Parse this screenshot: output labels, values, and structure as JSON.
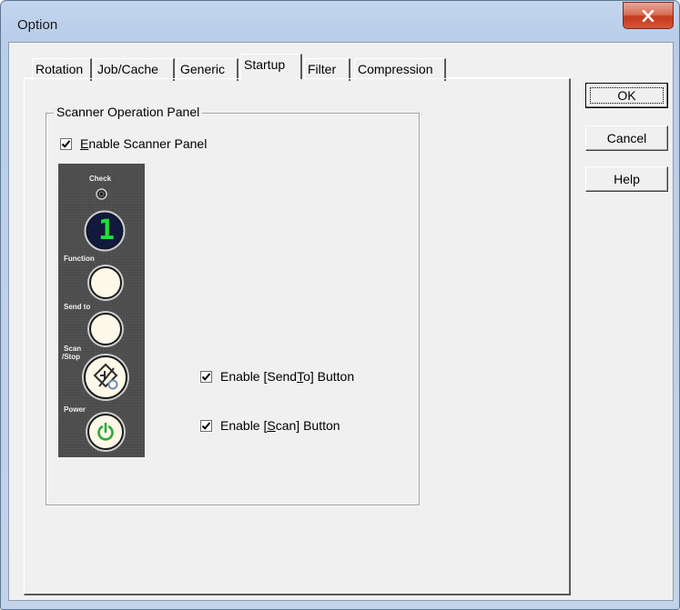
{
  "window": {
    "title": "Option",
    "close_glyph": "✕"
  },
  "tabs": [
    {
      "label": "Rotation",
      "active": false
    },
    {
      "label": "Job/Cache",
      "active": false
    },
    {
      "label": "Generic",
      "active": false
    },
    {
      "label": "Startup",
      "active": true
    },
    {
      "label": "Filter",
      "active": false
    },
    {
      "label": "Compression",
      "active": false
    }
  ],
  "group": {
    "label": "Scanner Operation Panel"
  },
  "enable_panel": {
    "mnemonic": "E",
    "rest": "nable Scanner Panel",
    "checked": true
  },
  "scanner_panel": {
    "check_label": "Check",
    "function_label": "Function",
    "sendto_label": "Send to",
    "scan_label_1": "Scan",
    "scan_label_2": "/Stop",
    "power_label": "Power",
    "display_digit": "1",
    "display_color": "#22e03a",
    "power_color": "#2fa83a"
  },
  "enable_sendto": {
    "before": "Enable [Send",
    "mnemonic": "T",
    "after": "o] Button",
    "checked": true
  },
  "enable_scan": {
    "before": "Enable [",
    "mnemonic": "S",
    "after": "can] Button",
    "checked": true
  },
  "buttons": {
    "ok": "OK",
    "cancel": "Cancel",
    "help": "Help"
  }
}
